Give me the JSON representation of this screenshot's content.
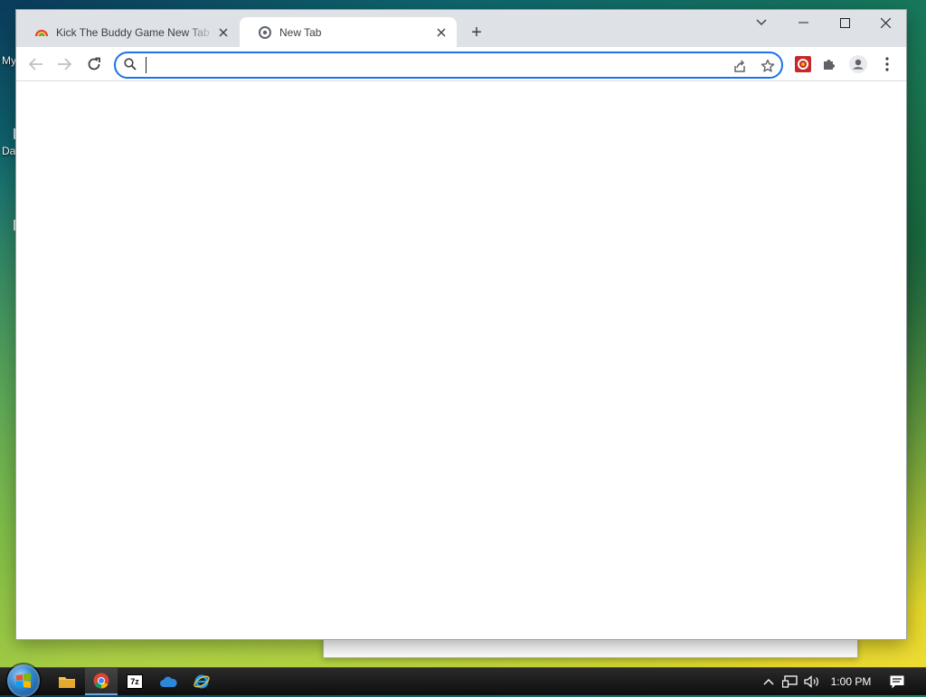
{
  "desktop": {
    "icon_labels": [
      "My",
      "Da"
    ]
  },
  "browser": {
    "tabs": [
      {
        "title": "Kick The Buddy Game New Tab -",
        "active": false,
        "icon": "rainbow-favicon-icon"
      },
      {
        "title": "New Tab",
        "active": true,
        "icon": "chrome-favicon-icon"
      }
    ],
    "new_tab_label": "+",
    "omnibox": {
      "value": "",
      "placeholder": ""
    },
    "accent_color": "#1a73e8"
  },
  "taskbar": {
    "apps": [
      "file-explorer-icon",
      "chrome-icon",
      "7zip-icon",
      "onedrive-icon",
      "internet-explorer-icon"
    ],
    "sevenzip_label": "7z",
    "clock": "1:00 PM"
  }
}
